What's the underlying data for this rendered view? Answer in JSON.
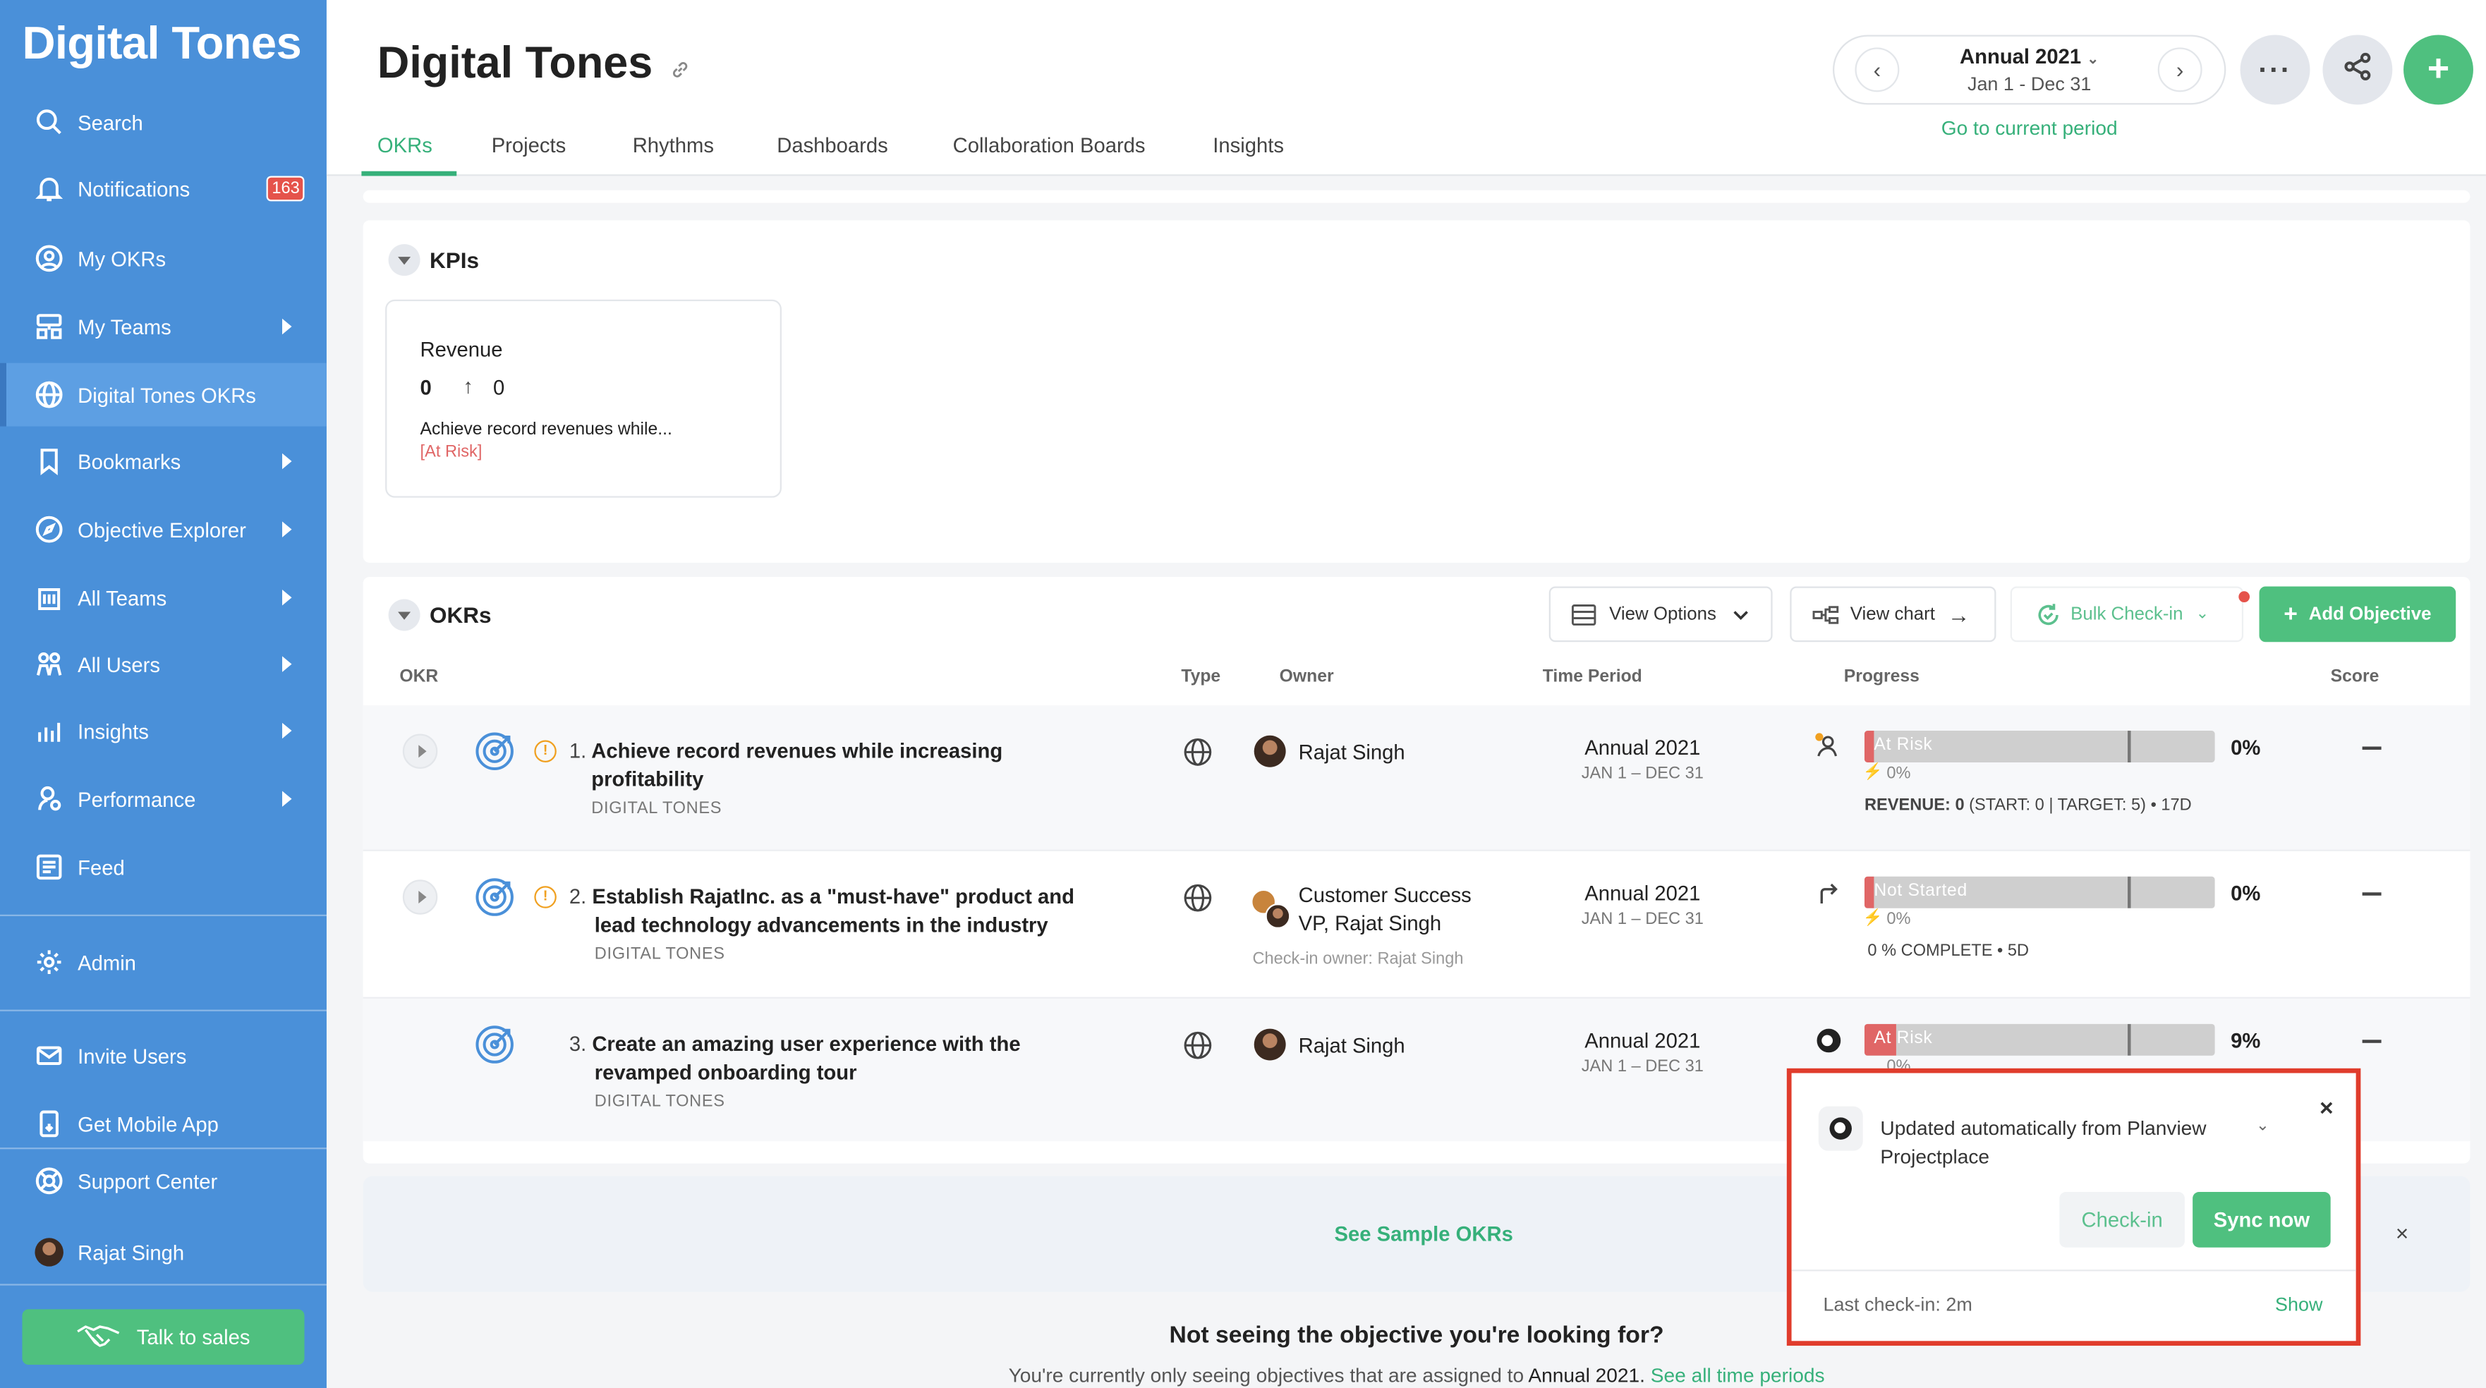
{
  "sidebar": {
    "brand": "Digital Tones",
    "items": [
      {
        "label": "Search"
      },
      {
        "label": "Notifications",
        "badge": "163"
      },
      {
        "label": "My OKRs"
      },
      {
        "label": "My Teams"
      },
      {
        "label": "Digital Tones OKRs"
      },
      {
        "label": "Bookmarks"
      },
      {
        "label": "Objective Explorer"
      },
      {
        "label": "All Teams"
      },
      {
        "label": "All Users"
      },
      {
        "label": "Insights"
      },
      {
        "label": "Performance"
      },
      {
        "label": "Feed"
      },
      {
        "label": "Admin"
      },
      {
        "label": "Invite Users"
      },
      {
        "label": "Get Mobile App"
      },
      {
        "label": "Support Center"
      },
      {
        "label": "Rajat Singh"
      }
    ],
    "talk_to_sales": "Talk to sales",
    "color": "#4a90d9"
  },
  "header": {
    "title": "Digital Tones",
    "tabs": [
      "OKRs",
      "Projects",
      "Rhythms",
      "Dashboards",
      "Collaboration Boards",
      "Insights"
    ],
    "period_name": "Annual 2021",
    "period_range": "Jan 1 - Dec 31",
    "go_current": "Go to current period"
  },
  "kpis": {
    "title": "KPIs",
    "card": {
      "name": "Revenue",
      "value": "0",
      "target": "0",
      "objective": "Achieve record revenues while...",
      "status": "[At Risk]"
    }
  },
  "okrs": {
    "title": "OKRs",
    "toolbar": {
      "view_options": "View Options",
      "view_chart": "View chart",
      "bulk_checkin": "Bulk Check-in",
      "add_objective": "Add Objective"
    },
    "columns": [
      "OKR",
      "Type",
      "Owner",
      "Time Period",
      "Progress",
      "Score"
    ],
    "rows": [
      {
        "num": "1.",
        "title_line1": "Achieve record revenues while increasing",
        "title_line2": "profitability",
        "team": "DIGITAL TONES",
        "owner": "Rajat Singh",
        "period": "Annual 2021",
        "period_range": "JAN 1 – DEC 31",
        "status": "At Risk",
        "progress": 0,
        "pct": "0%",
        "subpct": "0%",
        "kr_label": "REVENUE: 0",
        "kr_detail": " (START: 0 | TARGET: 5) • 17D",
        "score": "—"
      },
      {
        "num": "2.",
        "title_line1": "Establish RajatInc. as a \"must-have\" product and",
        "title_line2": "lead technology advancements in the industry",
        "team": "DIGITAL TONES",
        "owner_line1": "Customer Success",
        "owner_line2": "VP, Rajat Singh",
        "checkin_owner": "Check-in owner: Rajat Singh",
        "period": "Annual 2021",
        "period_range": "JAN 1 – DEC 31",
        "status": "Not Started",
        "progress": 0,
        "pct": "0%",
        "subpct": "0%",
        "complete": "0 % COMPLETE • 5D",
        "score": "—"
      },
      {
        "num": "3.",
        "title_line1": "Create an amazing user experience with the",
        "title_line2": "revamped onboarding tour",
        "team": "DIGITAL TONES",
        "owner": "Rajat Singh",
        "period": "Annual 2021",
        "period_range": "JAN 1 – DEC 31",
        "status": "At Risk",
        "progress": 0.09,
        "pct": "9%",
        "subpct": "0%",
        "score": "—"
      }
    ]
  },
  "sample": {
    "link": "See Sample OKRs",
    "not_seeing": "Not seeing the objective you're looking for?",
    "current_prefix": "You're currently only seeing objectives that are assigned to ",
    "current_period": "Annual 2021.",
    "see_all": "See all time periods"
  },
  "popup": {
    "message_line1": "Updated automatically from Planview",
    "message_line2": "Projectplace",
    "checkin": "Check-in",
    "sync_now": "Sync now",
    "last_checkin": "Last check-in: 2m",
    "show": "Show"
  },
  "colors": {
    "accent_green": "#36b07a",
    "at_risk": "#e06666",
    "highlight_border": "#e03c2c"
  }
}
